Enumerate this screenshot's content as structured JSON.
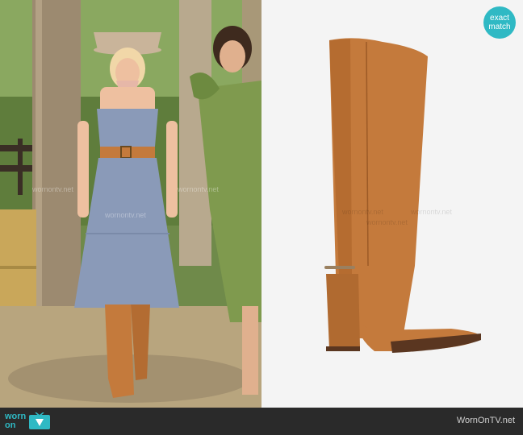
{
  "badge": {
    "line1": "exact",
    "line2": "match"
  },
  "footer": {
    "logo_line1": "worn",
    "logo_line2": "on",
    "logo_icon": "tv-icon",
    "site_name": "WornOnTV.net"
  },
  "watermark": "wornontv.net",
  "colors": {
    "accent": "#2fb9c4",
    "footer_bg": "#2a2a2a",
    "boot_leather": "#c47a3c",
    "dress_blue": "#8a9ab8",
    "dress_green": "#7f9a4e"
  }
}
